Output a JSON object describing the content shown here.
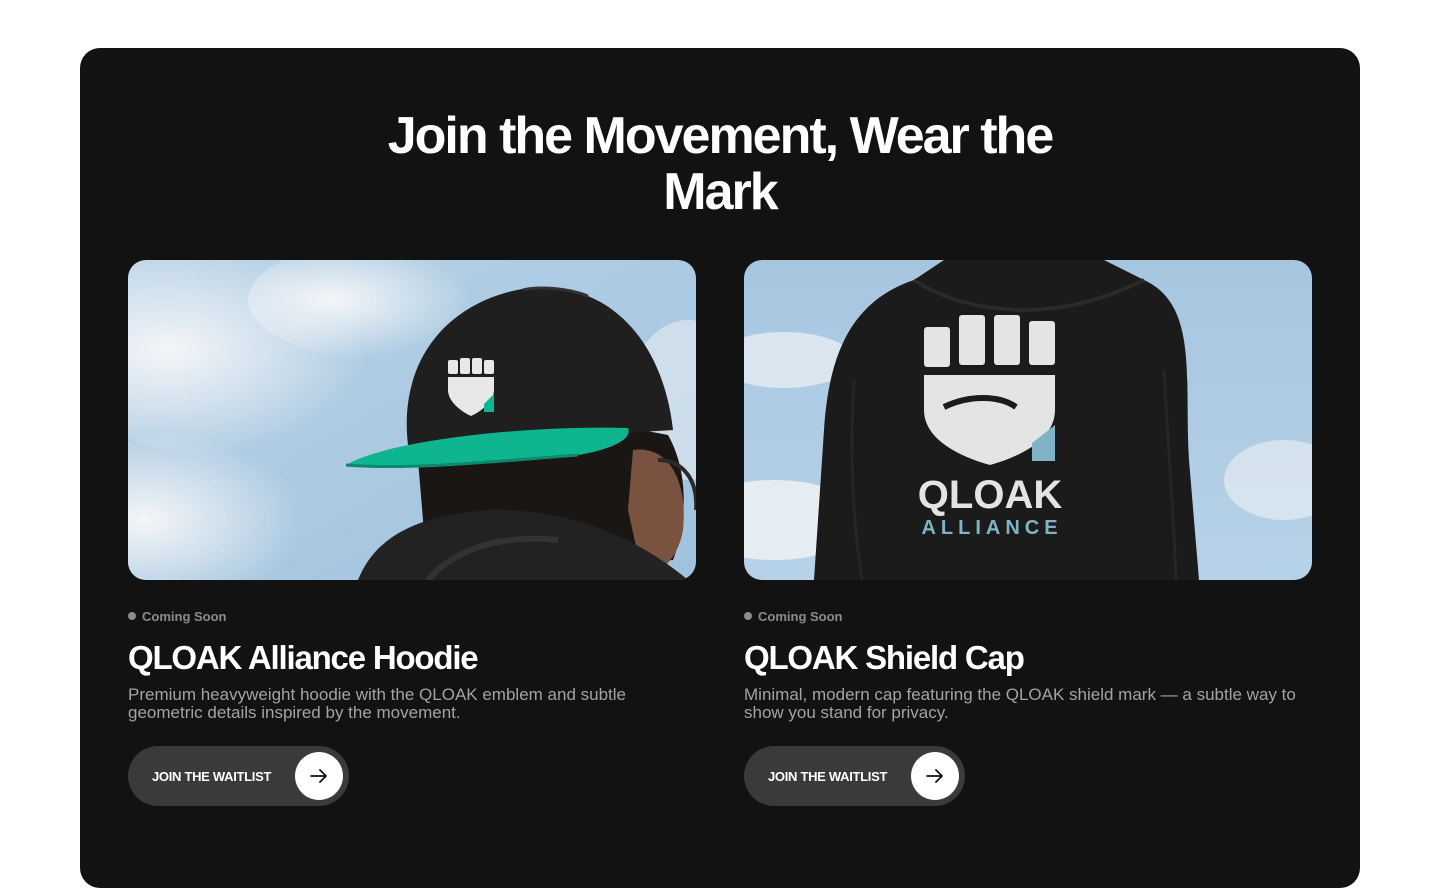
{
  "section": {
    "headline_line1": "Join the Movement, Wear the",
    "headline_line2": "Mark"
  },
  "products": [
    {
      "status": "Coming Soon",
      "title": "QLOAK Alliance Hoodie",
      "description": "Premium heavyweight hoodie with the QLOAK emblem and subtle geometric details inspired by the movement.",
      "button_label": "JOIN THE WAITLIST",
      "image_subject": "person wearing black cap with green brim and fist emblem"
    },
    {
      "status": "Coming Soon",
      "title": "QLOAK Shield Cap",
      "description": "Minimal, modern cap featuring the QLOAK shield mark — a subtle way to show you stand for privacy.",
      "button_label": "JOIN THE WAITLIST",
      "image_subject": "back of black hoodie with QLOAK ALLIANCE shield print"
    }
  ],
  "hoodie_print": {
    "brand": "QLOAK",
    "sub": "ALLIANCE"
  },
  "colors": {
    "panel": "#121212",
    "page": "#ffffff",
    "button": "#3a3a3a",
    "status": "#8c8c8c",
    "brim": "#0fb58f",
    "sky": "#a9c8e2"
  },
  "icons": {
    "button_icon": "arrow-right-icon",
    "status_icon": "dot-icon"
  }
}
